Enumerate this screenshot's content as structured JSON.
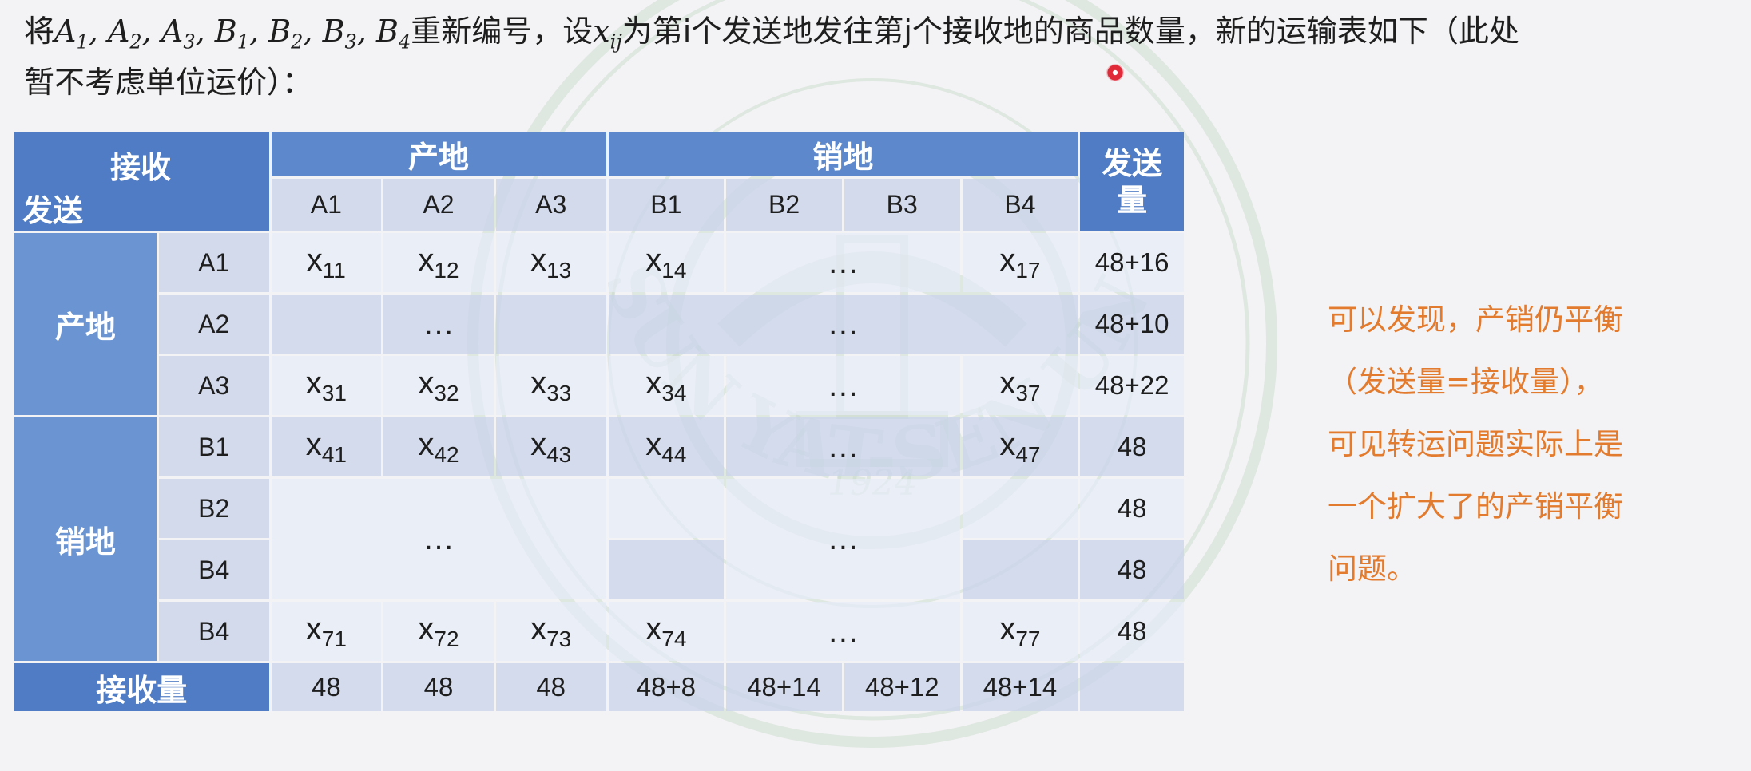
{
  "intro": {
    "p1": "将",
    "v1": "A",
    "s1": "1",
    "v2": "A",
    "s2": "2",
    "v3": "A",
    "s3": "3",
    "v4": "B",
    "s4": "1",
    "v5": "B",
    "s5": "2",
    "v6": "B",
    "s6": "3",
    "v7": "B",
    "s7": "4",
    "comma": ",",
    "p2": "重新编号，设",
    "xv": "x",
    "xs": "ij",
    "p3": "为第i个发送地发往第j个接收地的商品数量，新的运输表如下（此处",
    "p4": "暂不考虑单位运价）："
  },
  "table": {
    "corner_top": "接收",
    "corner_bottom": "发送",
    "group_origin": "产地",
    "group_sales": "销地",
    "send_header": "发送量",
    "send_header_l1": "发送",
    "send_header_l2": "量",
    "cols": [
      "A1",
      "A2",
      "A3",
      "B1",
      "B2",
      "B3",
      "B4"
    ],
    "row_groups": [
      "产地",
      "销地"
    ],
    "rows": [
      "A1",
      "A2",
      "A3",
      "B1",
      "B2",
      "B4",
      "B4"
    ],
    "ellipsis": "…",
    "cells": {
      "r1": [
        {
          "v": "x",
          "s": "11"
        },
        {
          "v": "x",
          "s": "12"
        },
        {
          "v": "x",
          "s": "13"
        },
        {
          "v": "x",
          "s": "14"
        },
        {
          "v": "x",
          "s": "17"
        }
      ],
      "r3": [
        {
          "v": "x",
          "s": "31"
        },
        {
          "v": "x",
          "s": "32"
        },
        {
          "v": "x",
          "s": "33"
        },
        {
          "v": "x",
          "s": "34"
        },
        {
          "v": "x",
          "s": "37"
        }
      ],
      "r4": [
        {
          "v": "x",
          "s": "41"
        },
        {
          "v": "x",
          "s": "42"
        },
        {
          "v": "x",
          "s": "43"
        },
        {
          "v": "x",
          "s": "44"
        },
        {
          "v": "x",
          "s": "47"
        }
      ],
      "r7": [
        {
          "v": "x",
          "s": "71"
        },
        {
          "v": "x",
          "s": "72"
        },
        {
          "v": "x",
          "s": "73"
        },
        {
          "v": "x",
          "s": "74"
        },
        {
          "v": "x",
          "s": "77"
        }
      ]
    },
    "send_amounts": [
      "48+16",
      "48+10",
      "48+22",
      "48",
      "48",
      "48",
      "48"
    ],
    "receive_label": "接收量",
    "receive_amounts": [
      "48",
      "48",
      "48",
      "48+8",
      "48+14",
      "48+12",
      "48+14"
    ]
  },
  "note": [
    "可以发现，产销仍平衡",
    "（发送量=接收量），",
    "可见转运问题实际上是",
    "一个扩大了的产销平衡",
    "问题。"
  ],
  "watermark": {
    "arc_text": "SUN YAT-SEN UNIVERSITY",
    "year": "1924"
  },
  "colors": {
    "header_blue": "#4f7cc4",
    "cell_light": "#cbd5ea",
    "note_orange": "#e37b2e",
    "watermark_green": "#8fb48f"
  }
}
